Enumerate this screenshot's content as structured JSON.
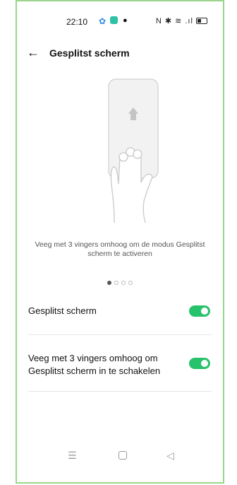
{
  "status_bar": {
    "time": "22:10",
    "notification_icons": [
      "gear-icon",
      "app-icon",
      "location-icon"
    ],
    "system_icons_text": "N ✱ ≋ .ıl"
  },
  "header": {
    "back_icon": "←",
    "title": "Gesplitst scherm"
  },
  "illustration": {
    "caption": "Veeg met 3 vingers omhoog om de modus Gesplitst scherm te activeren",
    "page_indicator": {
      "count": 4,
      "active": 0
    }
  },
  "settings": [
    {
      "label": "Gesplitst scherm",
      "enabled": true
    },
    {
      "label": "Veeg met 3 vingers omhoog om Gesplitst scherm in te schakelen",
      "enabled": true
    }
  ],
  "colors": {
    "toggle_on": "#27c26b",
    "frame_border": "#9ad58b",
    "accent_blue": "#2f8de0"
  },
  "nav_bar": {
    "menu_icon": "☰",
    "back_icon": "◁"
  }
}
